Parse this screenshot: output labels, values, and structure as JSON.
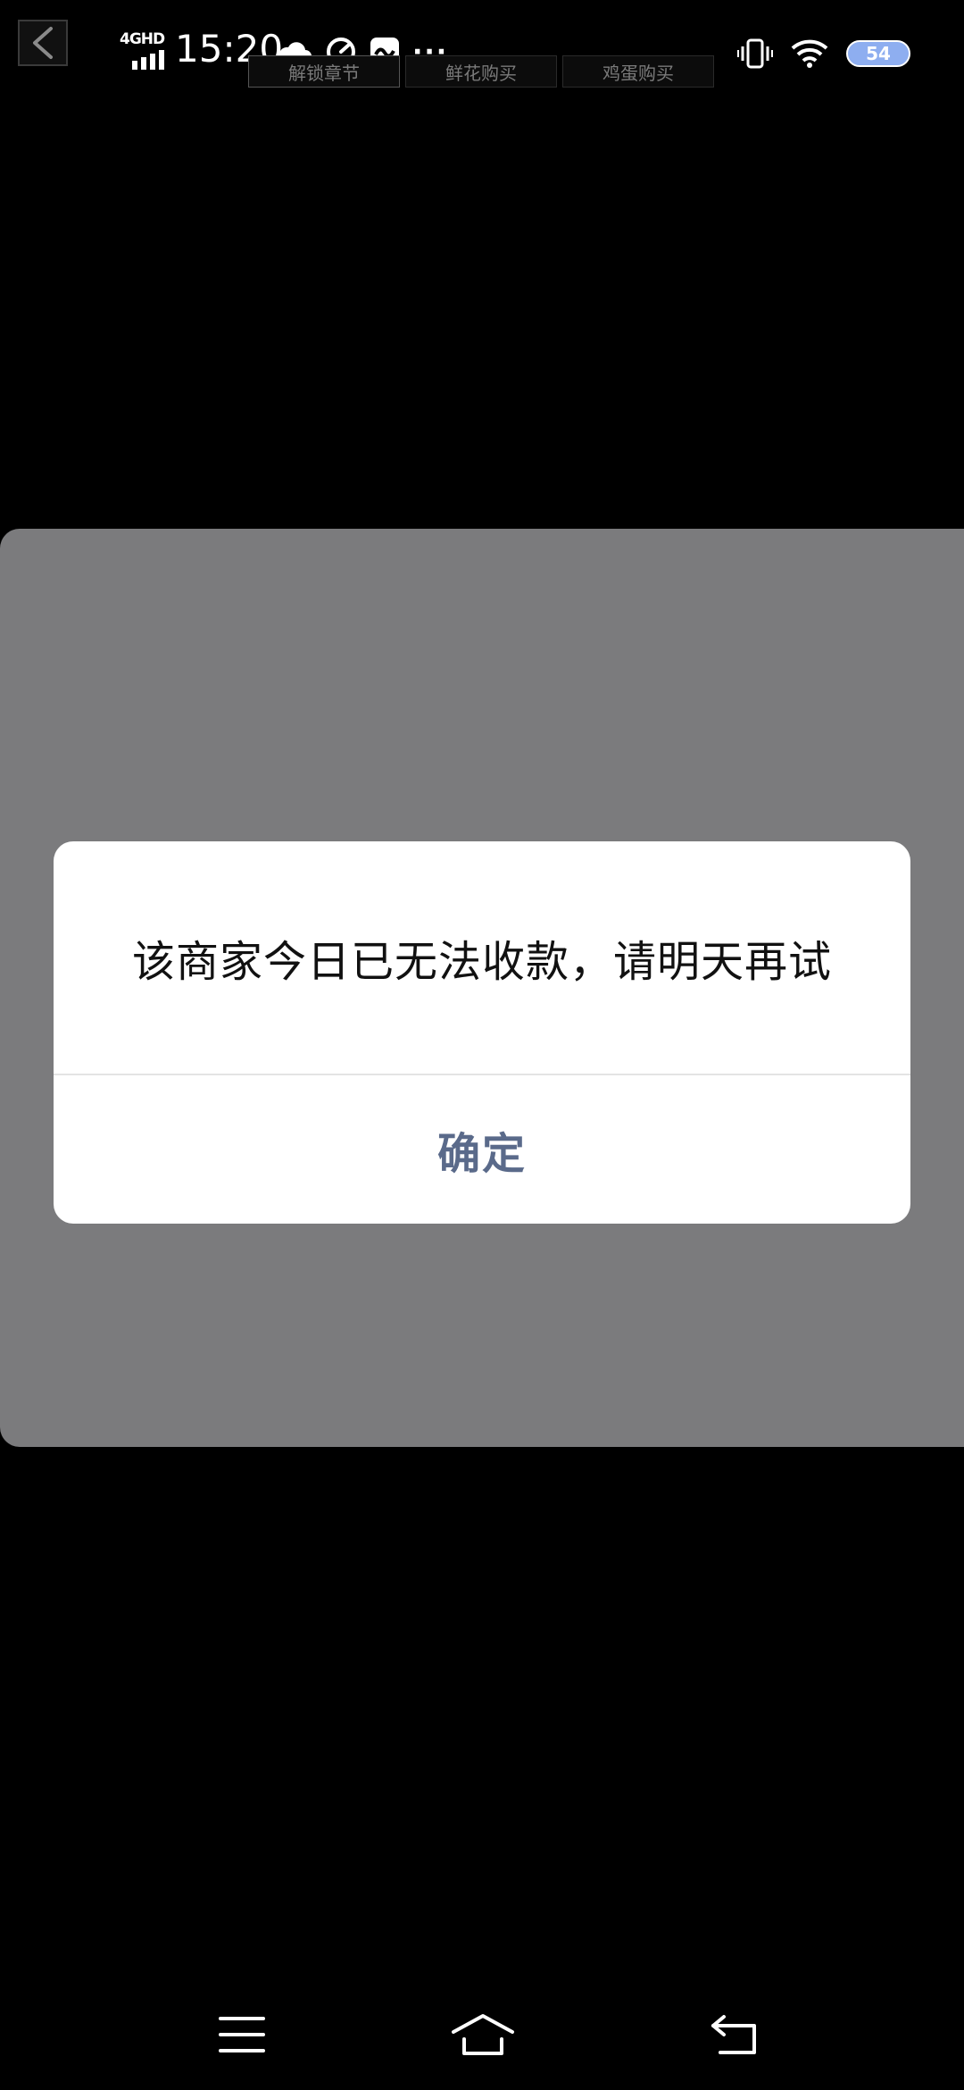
{
  "status_bar": {
    "network": "4GHD",
    "time": "15:20",
    "more": "···",
    "battery": "54",
    "icons_left": [
      "cloud-icon",
      "speedometer-icon",
      "message-app-icon"
    ],
    "icons_right": [
      "vibrate-icon",
      "wifi-icon",
      "battery-icon"
    ]
  },
  "top_tabs": [
    {
      "label": "解锁章节"
    },
    {
      "label": "鲜花购买"
    },
    {
      "label": "鸡蛋购买"
    }
  ],
  "dialog": {
    "message": "该商家今日已无法收款，请明天再试",
    "confirm_label": "确定"
  },
  "nav_bar": {
    "items": [
      "menu-icon",
      "home-icon",
      "back-icon"
    ]
  },
  "colors": {
    "background": "#000000",
    "overlay": "#7b7b7d",
    "dialog_bg": "#ffffff",
    "confirm_text": "#5a6a8a",
    "battery_fill": "#8eaef0"
  }
}
